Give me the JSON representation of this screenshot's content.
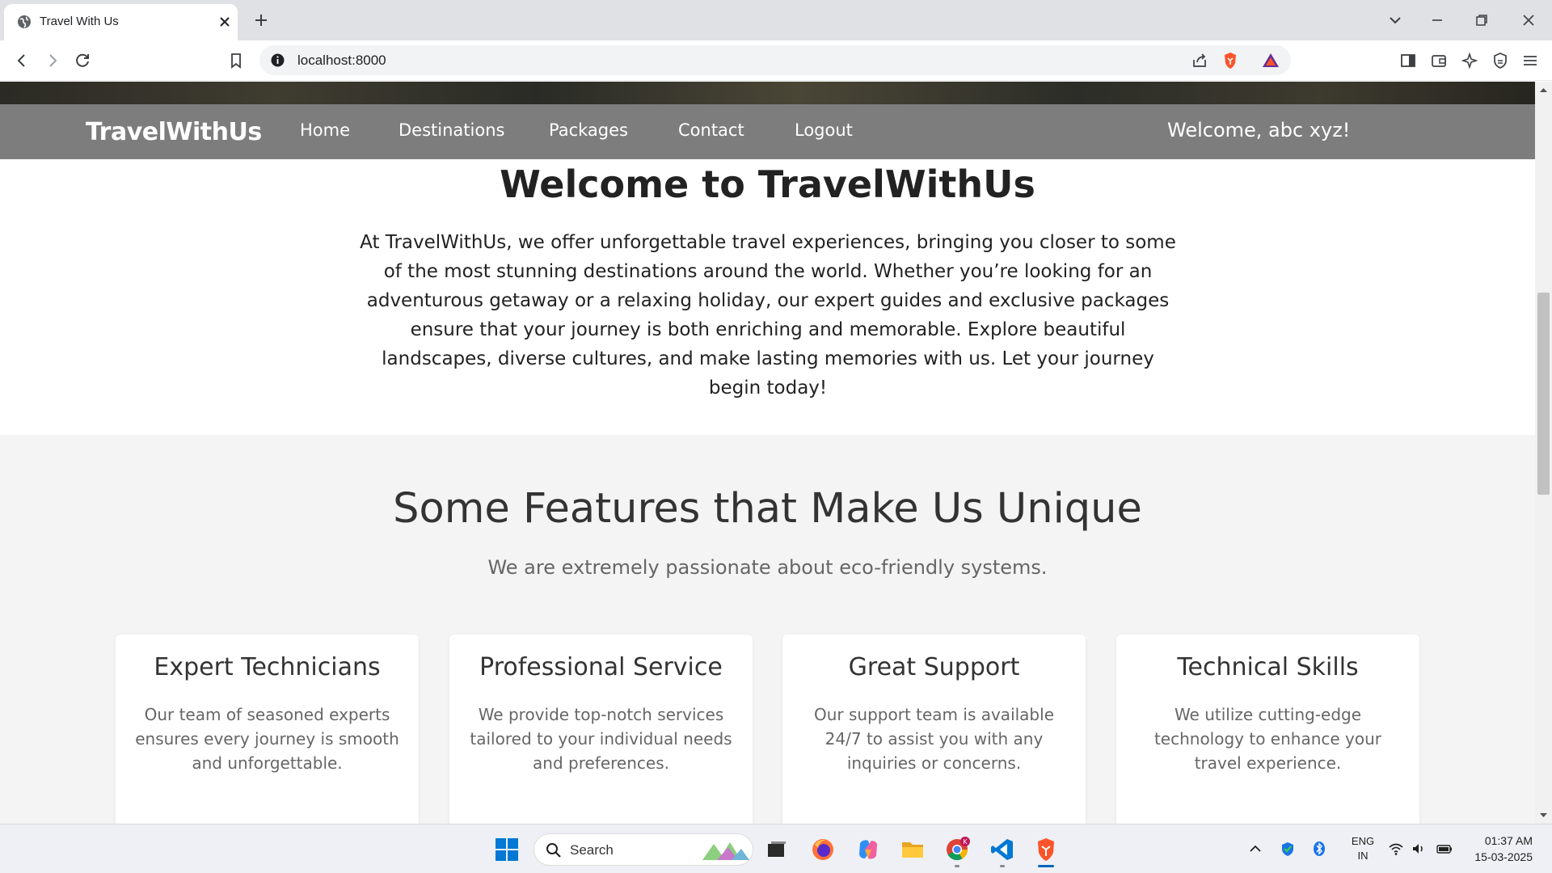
{
  "browser": {
    "tab_title": "Travel With Us",
    "url": "localhost:8000"
  },
  "site": {
    "brand": "TravelWithUs",
    "nav": [
      "Home",
      "Destinations",
      "Packages",
      "Contact",
      "Logout"
    ],
    "welcome_user": "Welcome, abc xyz!"
  },
  "intro": {
    "title": "Welcome to TravelWithUs",
    "text": "At TravelWithUs, we offer unforgettable travel experiences, bringing you closer to some of the most stunning destinations around the world. Whether you’re looking for an adventurous getaway or a relaxing holiday, our expert guides and exclusive packages ensure that your journey is both enriching and memorable. Explore beautiful landscapes, diverse cultures, and make lasting memories with us. Let your journey begin today!"
  },
  "features": {
    "title": "Some Features that Make Us Unique",
    "subtitle": "We are extremely passionate about eco-friendly systems.",
    "cards": [
      {
        "title": "Expert Technicians",
        "description": "Our team of seasoned experts ensures every journey is smooth and unforgettable."
      },
      {
        "title": "Professional Service",
        "description": "We provide top-notch services tailored to your individual needs and preferences."
      },
      {
        "title": "Great Support",
        "description": "Our support team is available 24/7 to assist you with any inquiries or concerns."
      },
      {
        "title": "Technical Skills",
        "description": "We utilize cutting-edge technology to enhance your travel experience."
      }
    ]
  },
  "taskbar": {
    "search_label": "Search",
    "lang_line1": "ENG",
    "lang_line2": "IN",
    "time": "01:37 AM",
    "date": "15-03-2025",
    "chrome_badge": "K"
  },
  "colors": {
    "nav_bg": "#7d7d7d",
    "features_bg": "#f4f4f4",
    "brave_orange": "#fb542b",
    "vscode_blue": "#0078d4"
  }
}
